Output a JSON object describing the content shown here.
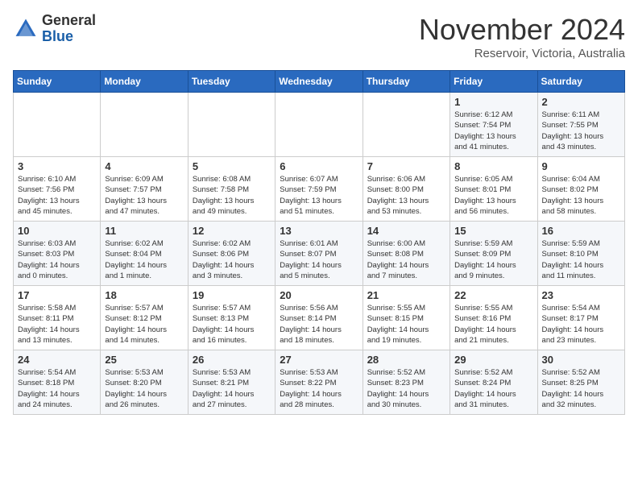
{
  "header": {
    "logo_general": "General",
    "logo_blue": "Blue",
    "month_title": "November 2024",
    "location": "Reservoir, Victoria, Australia"
  },
  "weekdays": [
    "Sunday",
    "Monday",
    "Tuesday",
    "Wednesday",
    "Thursday",
    "Friday",
    "Saturday"
  ],
  "weeks": [
    [
      {
        "day": "",
        "info": ""
      },
      {
        "day": "",
        "info": ""
      },
      {
        "day": "",
        "info": ""
      },
      {
        "day": "",
        "info": ""
      },
      {
        "day": "",
        "info": ""
      },
      {
        "day": "1",
        "info": "Sunrise: 6:12 AM\nSunset: 7:54 PM\nDaylight: 13 hours\nand 41 minutes."
      },
      {
        "day": "2",
        "info": "Sunrise: 6:11 AM\nSunset: 7:55 PM\nDaylight: 13 hours\nand 43 minutes."
      }
    ],
    [
      {
        "day": "3",
        "info": "Sunrise: 6:10 AM\nSunset: 7:56 PM\nDaylight: 13 hours\nand 45 minutes."
      },
      {
        "day": "4",
        "info": "Sunrise: 6:09 AM\nSunset: 7:57 PM\nDaylight: 13 hours\nand 47 minutes."
      },
      {
        "day": "5",
        "info": "Sunrise: 6:08 AM\nSunset: 7:58 PM\nDaylight: 13 hours\nand 49 minutes."
      },
      {
        "day": "6",
        "info": "Sunrise: 6:07 AM\nSunset: 7:59 PM\nDaylight: 13 hours\nand 51 minutes."
      },
      {
        "day": "7",
        "info": "Sunrise: 6:06 AM\nSunset: 8:00 PM\nDaylight: 13 hours\nand 53 minutes."
      },
      {
        "day": "8",
        "info": "Sunrise: 6:05 AM\nSunset: 8:01 PM\nDaylight: 13 hours\nand 56 minutes."
      },
      {
        "day": "9",
        "info": "Sunrise: 6:04 AM\nSunset: 8:02 PM\nDaylight: 13 hours\nand 58 minutes."
      }
    ],
    [
      {
        "day": "10",
        "info": "Sunrise: 6:03 AM\nSunset: 8:03 PM\nDaylight: 14 hours\nand 0 minutes."
      },
      {
        "day": "11",
        "info": "Sunrise: 6:02 AM\nSunset: 8:04 PM\nDaylight: 14 hours\nand 1 minute."
      },
      {
        "day": "12",
        "info": "Sunrise: 6:02 AM\nSunset: 8:06 PM\nDaylight: 14 hours\nand 3 minutes."
      },
      {
        "day": "13",
        "info": "Sunrise: 6:01 AM\nSunset: 8:07 PM\nDaylight: 14 hours\nand 5 minutes."
      },
      {
        "day": "14",
        "info": "Sunrise: 6:00 AM\nSunset: 8:08 PM\nDaylight: 14 hours\nand 7 minutes."
      },
      {
        "day": "15",
        "info": "Sunrise: 5:59 AM\nSunset: 8:09 PM\nDaylight: 14 hours\nand 9 minutes."
      },
      {
        "day": "16",
        "info": "Sunrise: 5:59 AM\nSunset: 8:10 PM\nDaylight: 14 hours\nand 11 minutes."
      }
    ],
    [
      {
        "day": "17",
        "info": "Sunrise: 5:58 AM\nSunset: 8:11 PM\nDaylight: 14 hours\nand 13 minutes."
      },
      {
        "day": "18",
        "info": "Sunrise: 5:57 AM\nSunset: 8:12 PM\nDaylight: 14 hours\nand 14 minutes."
      },
      {
        "day": "19",
        "info": "Sunrise: 5:57 AM\nSunset: 8:13 PM\nDaylight: 14 hours\nand 16 minutes."
      },
      {
        "day": "20",
        "info": "Sunrise: 5:56 AM\nSunset: 8:14 PM\nDaylight: 14 hours\nand 18 minutes."
      },
      {
        "day": "21",
        "info": "Sunrise: 5:55 AM\nSunset: 8:15 PM\nDaylight: 14 hours\nand 19 minutes."
      },
      {
        "day": "22",
        "info": "Sunrise: 5:55 AM\nSunset: 8:16 PM\nDaylight: 14 hours\nand 21 minutes."
      },
      {
        "day": "23",
        "info": "Sunrise: 5:54 AM\nSunset: 8:17 PM\nDaylight: 14 hours\nand 23 minutes."
      }
    ],
    [
      {
        "day": "24",
        "info": "Sunrise: 5:54 AM\nSunset: 8:18 PM\nDaylight: 14 hours\nand 24 minutes."
      },
      {
        "day": "25",
        "info": "Sunrise: 5:53 AM\nSunset: 8:20 PM\nDaylight: 14 hours\nand 26 minutes."
      },
      {
        "day": "26",
        "info": "Sunrise: 5:53 AM\nSunset: 8:21 PM\nDaylight: 14 hours\nand 27 minutes."
      },
      {
        "day": "27",
        "info": "Sunrise: 5:53 AM\nSunset: 8:22 PM\nDaylight: 14 hours\nand 28 minutes."
      },
      {
        "day": "28",
        "info": "Sunrise: 5:52 AM\nSunset: 8:23 PM\nDaylight: 14 hours\nand 30 minutes."
      },
      {
        "day": "29",
        "info": "Sunrise: 5:52 AM\nSunset: 8:24 PM\nDaylight: 14 hours\nand 31 minutes."
      },
      {
        "day": "30",
        "info": "Sunrise: 5:52 AM\nSunset: 8:25 PM\nDaylight: 14 hours\nand 32 minutes."
      }
    ]
  ]
}
